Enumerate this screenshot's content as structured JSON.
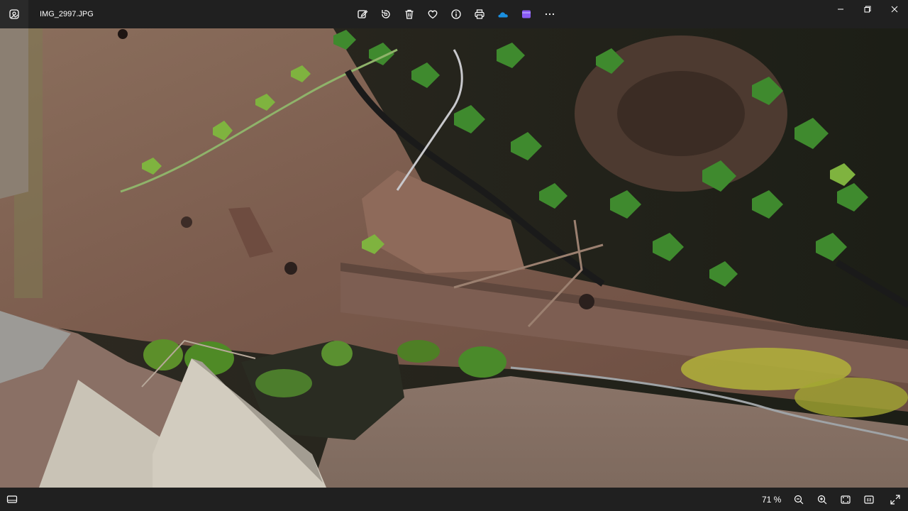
{
  "title_bar": {
    "file_name": "IMG_2997.JPG"
  },
  "toolbar": {
    "icons": [
      "edit-icon",
      "rotate-icon",
      "delete-icon",
      "favorite-icon",
      "info-icon",
      "print-icon",
      "onedrive-icon",
      "clipchamp-icon",
      "more-icon"
    ]
  },
  "window_controls": [
    "minimize-icon",
    "maximize-icon",
    "close-icon"
  ],
  "status_bar": {
    "zoom_label": "71 %"
  },
  "colors": {
    "chrome_bg": "#202020",
    "onedrive_blue": "#1a8fe0",
    "clipchamp_purple": "#8b5cf6"
  }
}
